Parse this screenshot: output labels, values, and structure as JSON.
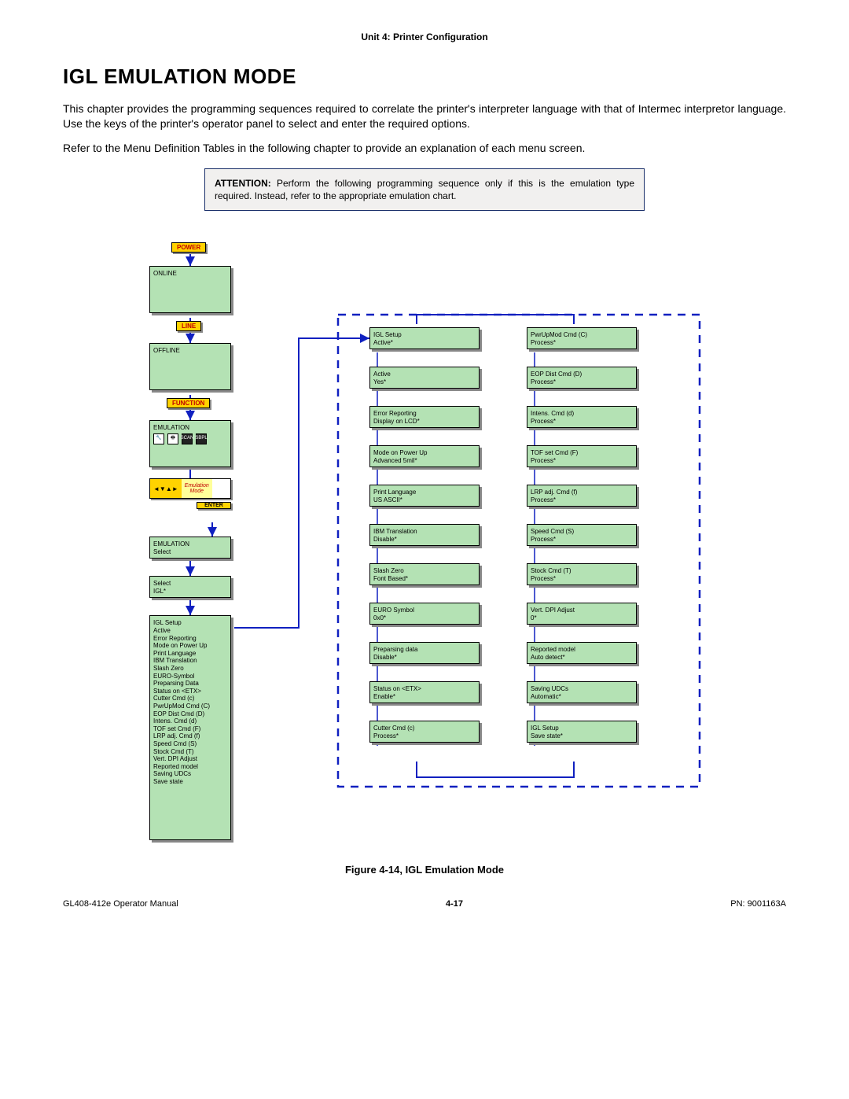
{
  "header": {
    "unit": "Unit 4: Printer Configuration"
  },
  "title": "Igl Emulation Mode",
  "paragraphs": {
    "p1": "This chapter provides the programming sequences required to correlate the printer's interpreter language with that of Intermec interpretor language. Use the keys of the printer's operator panel to select and enter the required options.",
    "p2": "Refer to the Menu Definition Tables in the following chapter to provide an explanation of each menu screen."
  },
  "attention": {
    "label": "ATTENTION:",
    "text": "Perform the following programming sequence only if this is the emulation type required. Instead, refer to the appropriate emulation chart."
  },
  "buttons": {
    "power": "POWER",
    "line": "LINE",
    "function": "FUNCTION",
    "nav_arrows": "◄▼▲►",
    "emulation_mode_top": "Emulation",
    "emulation_mode_bottom": "Mode",
    "enter": "ENTER"
  },
  "left_column": {
    "online": "ONLINE",
    "offline": "OFFLINE",
    "emulation": "EMULATION",
    "emulation_select_title": "EMULATION",
    "emulation_select_sub": "Select",
    "select_title": "Select",
    "select_val": "IGL*",
    "igl_setup_title": "IGL Setup",
    "igl_setup_items": [
      "Active",
      "Error Reporting",
      "Mode on Power Up",
      "Print Language",
      "IBM Translation",
      "Slash Zero",
      "EURO-Symbol",
      "Preparsing Data",
      "Status on <ETX>",
      "Cutter Cmd (c)",
      "PwrUpMod Cmd (C)",
      "EOP Dist Cmd (D)",
      "Intens. Cmd (d)",
      "TOF set Cmd (F)",
      "LRP adj. Cmd (f)",
      "Speed Cmd (S)",
      "Stock Cmd (T)",
      "Vert. DPI Adjust",
      "Reported model",
      "Saving UDCs",
      "Save state"
    ]
  },
  "mid_column": [
    {
      "t": "IGL Setup",
      "v": "Active*"
    },
    {
      "t": "Active",
      "v": "Yes*"
    },
    {
      "t": "Error Reporting",
      "v": "Display on LCD*"
    },
    {
      "t": "Mode on Power Up",
      "v": "Advanced 5mil*"
    },
    {
      "t": "Print Language",
      "v": "US ASCII*"
    },
    {
      "t": "IBM Translation",
      "v": "Disable*"
    },
    {
      "t": "Slash Zero",
      "v": "Font Based*"
    },
    {
      "t": "EURO Symbol",
      "v": "0x0*"
    },
    {
      "t": "Preparsing data",
      "v": "Disable*"
    },
    {
      "t": "Status on <ETX>",
      "v": "Enable*"
    },
    {
      "t": "Cutter Cmd (c)",
      "v": "Process*"
    }
  ],
  "right_column": [
    {
      "t": "PwrUpMod Cmd (C)",
      "v": "Process*"
    },
    {
      "t": "EOP Dist Cmd (D)",
      "v": "Process*"
    },
    {
      "t": "Intens. Cmd (d)",
      "v": "Process*"
    },
    {
      "t": "TOF set Cmd (F)",
      "v": "Process*"
    },
    {
      "t": "LRP adj. Cmd (f)",
      "v": "Process*"
    },
    {
      "t": "Speed Cmd (S)",
      "v": "Process*"
    },
    {
      "t": "Stock Cmd (T)",
      "v": "Process*"
    },
    {
      "t": "Vert. DPI Adjust",
      "v": "0*"
    },
    {
      "t": "Reported model",
      "v": "Auto detect*"
    },
    {
      "t": "Saving UDCs",
      "v": "Automatic*"
    },
    {
      "t": "IGL Setup",
      "v": "Save state*"
    }
  ],
  "figure_caption": "Figure 4-14, IGL Emulation Mode",
  "footer": {
    "left": "GL408-412e Operator Manual",
    "mid": "4-17",
    "right": "PN: 9001163A"
  }
}
